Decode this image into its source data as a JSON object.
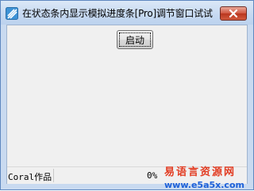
{
  "window": {
    "title": "在状态条内显示模拟进度条[Pro]调节窗口试试"
  },
  "buttons": {
    "start_label": "启动"
  },
  "statusbar": {
    "author_label": "Coral作品",
    "progress_text": "0%",
    "progress": 0
  },
  "watermark": {
    "site_name": "易语言资源网",
    "url": "www.e5a5x.com"
  },
  "icons": {
    "app": "app-icon",
    "close": "close-icon"
  },
  "colors": {
    "title_bg": "#c6d9f1",
    "close_red": "#c94a33",
    "client_bg": "#f0f0f0",
    "watermark_red": "#e23c22",
    "watermark_blue": "#1e61d8"
  }
}
